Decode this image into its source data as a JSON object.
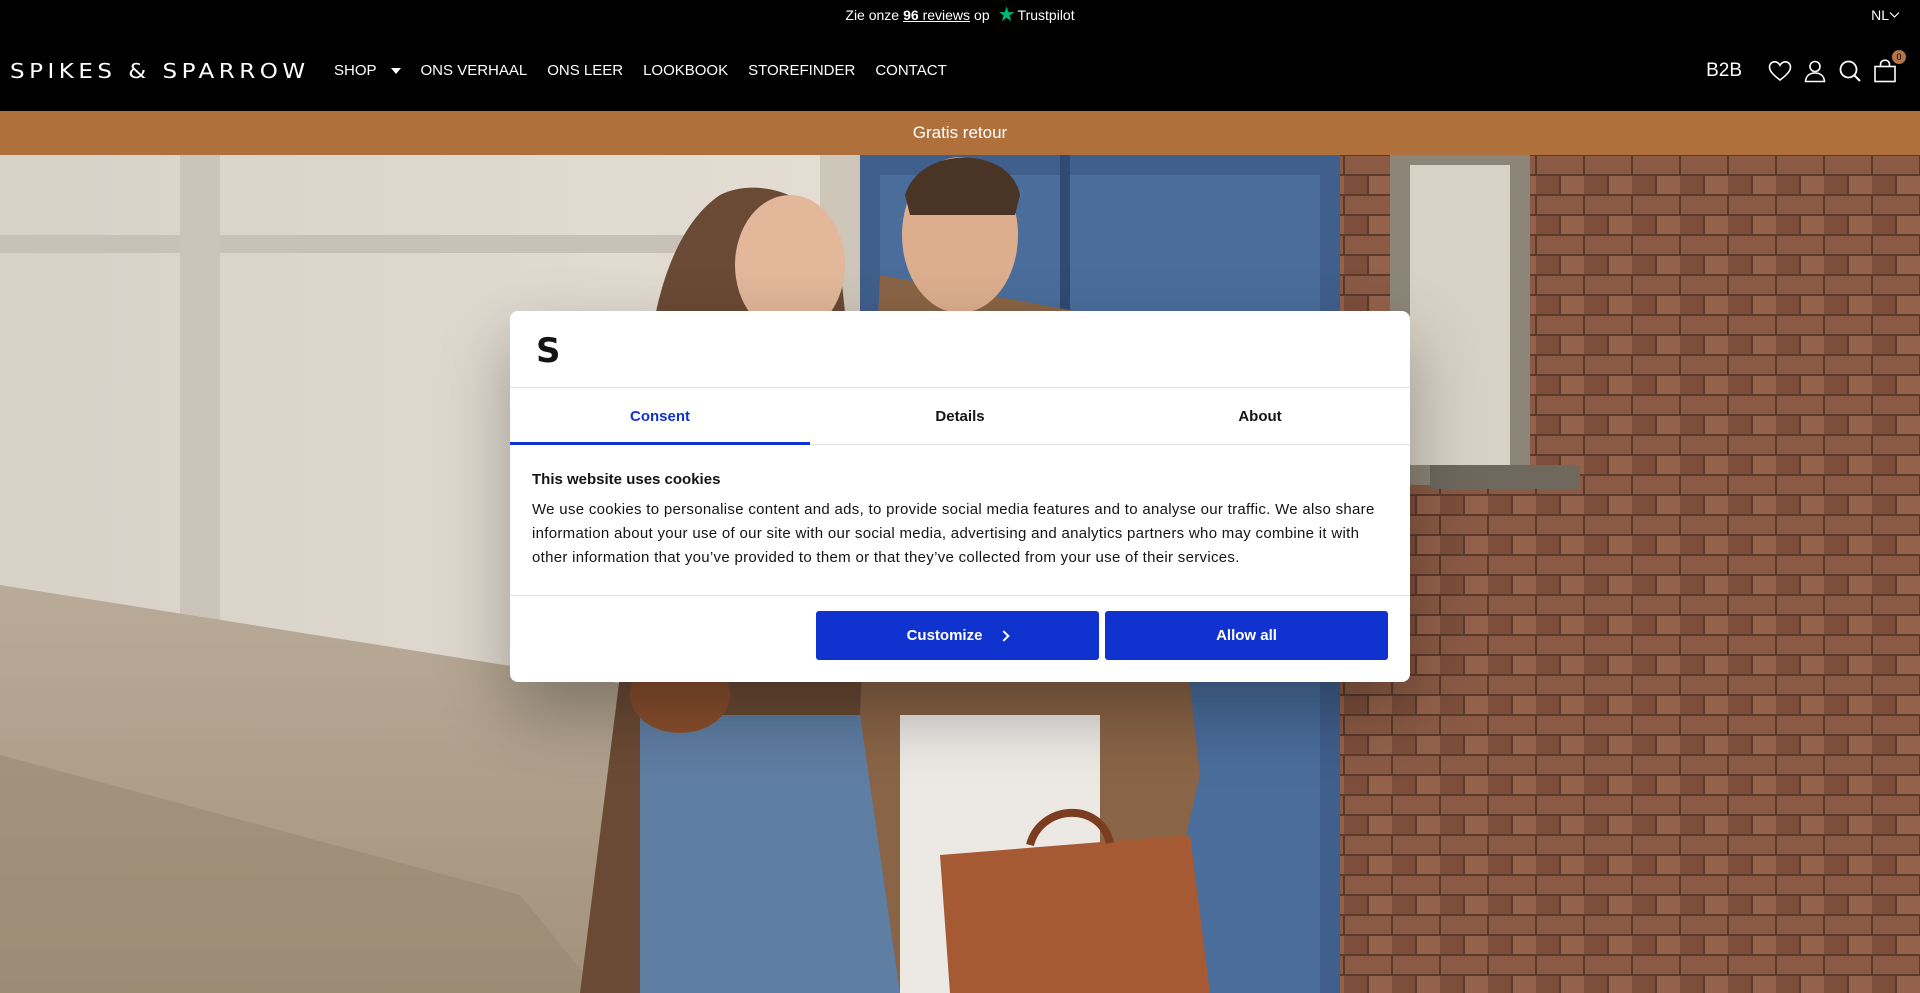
{
  "topbar": {
    "text_before": "Zie onze",
    "reviews_count": "96",
    "reviews_word": "reviews",
    "text_after": "op",
    "trustpilot": "Trustpilot",
    "language": "NL"
  },
  "header": {
    "logo": "SPIKES & SPARROW",
    "nav": [
      {
        "label": "SHOP"
      },
      {
        "label": "ONS VERHAAL"
      },
      {
        "label": "ONS LEER"
      },
      {
        "label": "LOOKBOOK"
      },
      {
        "label": "STOREFINDER"
      },
      {
        "label": "CONTACT"
      }
    ],
    "b2b": "B2B",
    "cart_count": "0"
  },
  "promo": {
    "text": "Gratis retour"
  },
  "cookie_dialog": {
    "logo": "S",
    "tabs": [
      {
        "label": "Consent",
        "active": true
      },
      {
        "label": "Details",
        "active": false
      },
      {
        "label": "About",
        "active": false
      }
    ],
    "title": "This website uses cookies",
    "body": "We use cookies to personalise content and ads, to provide social media features and to analyse our traffic. We also share information about your use of our site with our social media, advertising and analytics partners who may combine it with other information that you’ve provided to them or that they’ve collected from your use of their services.",
    "customize_label": "Customize",
    "allow_all_label": "Allow all"
  },
  "colors": {
    "accent_blue": "#1032cf",
    "promo_brown": "#b0703c",
    "trustpilot_green": "#00b67a"
  }
}
